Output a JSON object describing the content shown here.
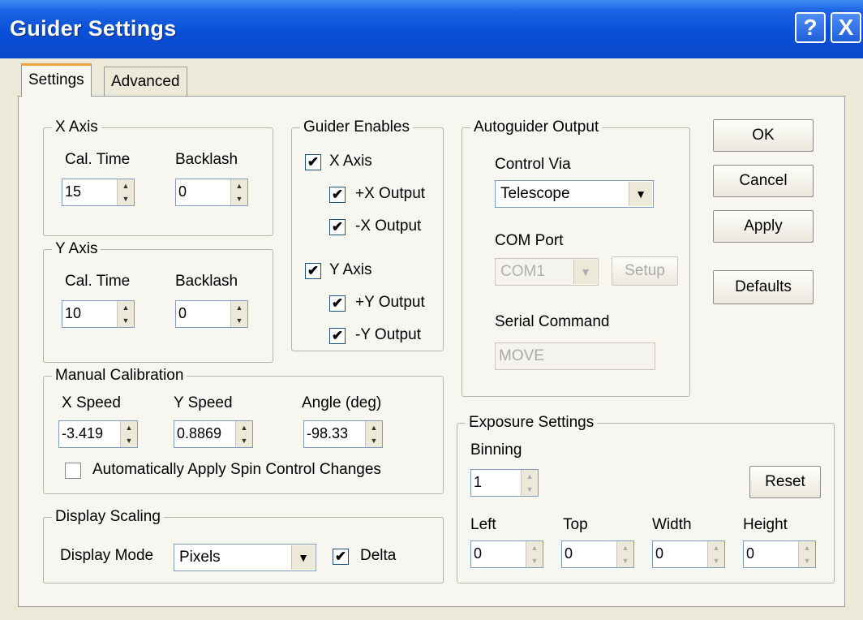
{
  "window": {
    "title": "Guider Settings",
    "help_glyph": "?",
    "close_glyph": "X"
  },
  "tabs": [
    {
      "label": "Settings",
      "active": true
    },
    {
      "label": "Advanced",
      "active": false
    }
  ],
  "x_axis": {
    "title": "X Axis",
    "cal_time_label": "Cal. Time",
    "cal_time_value": "15",
    "backlash_label": "Backlash",
    "backlash_value": "0"
  },
  "y_axis": {
    "title": "Y Axis",
    "cal_time_label": "Cal. Time",
    "cal_time_value": "10",
    "backlash_label": "Backlash",
    "backlash_value": "0"
  },
  "guider_enables": {
    "title": "Guider Enables",
    "x_axis": {
      "label": "X Axis",
      "checked": true
    },
    "plus_x": {
      "label": "+X Output",
      "checked": true
    },
    "minus_x": {
      "label": "-X Output",
      "checked": true
    },
    "y_axis": {
      "label": "Y Axis",
      "checked": true
    },
    "plus_y": {
      "label": "+Y Output",
      "checked": true
    },
    "minus_y": {
      "label": "-Y Output",
      "checked": true
    },
    "check_glyph": "✔"
  },
  "autoguider_output": {
    "title": "Autoguider Output",
    "control_via_label": "Control Via",
    "control_via_value": "Telescope",
    "com_port_label": "COM Port",
    "com_port_value": "COM1",
    "setup_label": "Setup",
    "serial_command_label": "Serial Command",
    "serial_command_value": "MOVE"
  },
  "buttons": {
    "ok": "OK",
    "cancel": "Cancel",
    "apply": "Apply",
    "defaults": "Defaults"
  },
  "manual_calibration": {
    "title": "Manual Calibration",
    "x_speed_label": "X Speed",
    "x_speed_value": "-3.419",
    "y_speed_label": "Y Speed",
    "y_speed_value": "0.8869",
    "angle_label": "Angle (deg)",
    "angle_value": "-98.33",
    "auto_apply_label": "Automatically Apply Spin Control Changes",
    "auto_apply_checked": false
  },
  "display_scaling": {
    "title": "Display Scaling",
    "mode_label": "Display Mode",
    "mode_value": "Pixels",
    "delta_label": "Delta",
    "delta_checked": true
  },
  "exposure_settings": {
    "title": "Exposure Settings",
    "binning_label": "Binning",
    "binning_value": "1",
    "reset_label": "Reset",
    "left_label": "Left",
    "left_value": "0",
    "top_label": "Top",
    "top_value": "0",
    "width_label": "Width",
    "width_value": "0",
    "height_label": "Height",
    "height_value": "0"
  },
  "glyphs": {
    "spin_up": "▲",
    "spin_down": "▼",
    "dropdown": "▼"
  }
}
